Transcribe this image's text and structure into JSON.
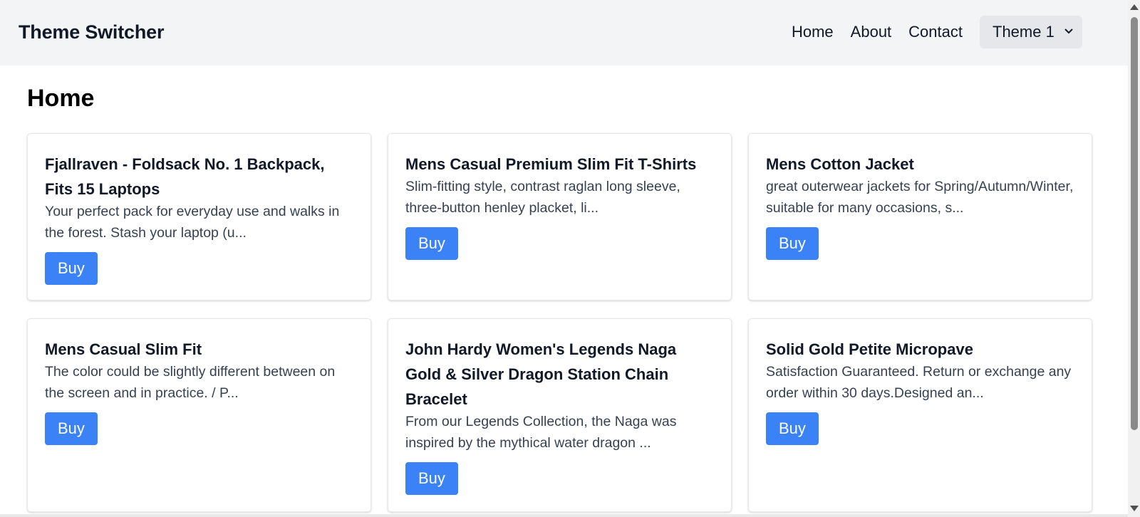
{
  "header": {
    "brand": "Theme Switcher",
    "nav": [
      "Home",
      "About",
      "Contact"
    ],
    "theme_select": {
      "selected": "Theme 1"
    }
  },
  "main": {
    "title": "Home",
    "products": [
      {
        "title": "Fjallraven - Foldsack No. 1 Backpack, Fits 15 Laptops",
        "desc": "Your perfect pack for everyday use and walks in the forest. Stash your laptop (u...",
        "button": "Buy"
      },
      {
        "title": "Mens Casual Premium Slim Fit T-Shirts",
        "desc": "Slim-fitting style, contrast raglan long sleeve, three-button henley placket, li...",
        "button": "Buy"
      },
      {
        "title": "Mens Cotton Jacket",
        "desc": "great outerwear jackets for Spring/Autumn/Winter, suitable for many occasions, s...",
        "button": "Buy"
      },
      {
        "title": "Mens Casual Slim Fit",
        "desc": "The color could be slightly different between on the screen and in practice. / P...",
        "button": "Buy"
      },
      {
        "title": "John Hardy Women's Legends Naga Gold & Silver Dragon Station Chain Bracelet",
        "desc": "From our Legends Collection, the Naga was inspired by the mythical water dragon ...",
        "button": "Buy"
      },
      {
        "title": "Solid Gold Petite Micropave",
        "desc": "Satisfaction Guaranteed. Return or exchange any order within 30 days.Designed an...",
        "button": "Buy"
      }
    ]
  },
  "colors": {
    "header_bg": "#f3f4f6",
    "button": "#3b82f6",
    "select_bg": "#e5e7eb"
  },
  "icons": {
    "select_chevron": "chevron-down-icon"
  }
}
